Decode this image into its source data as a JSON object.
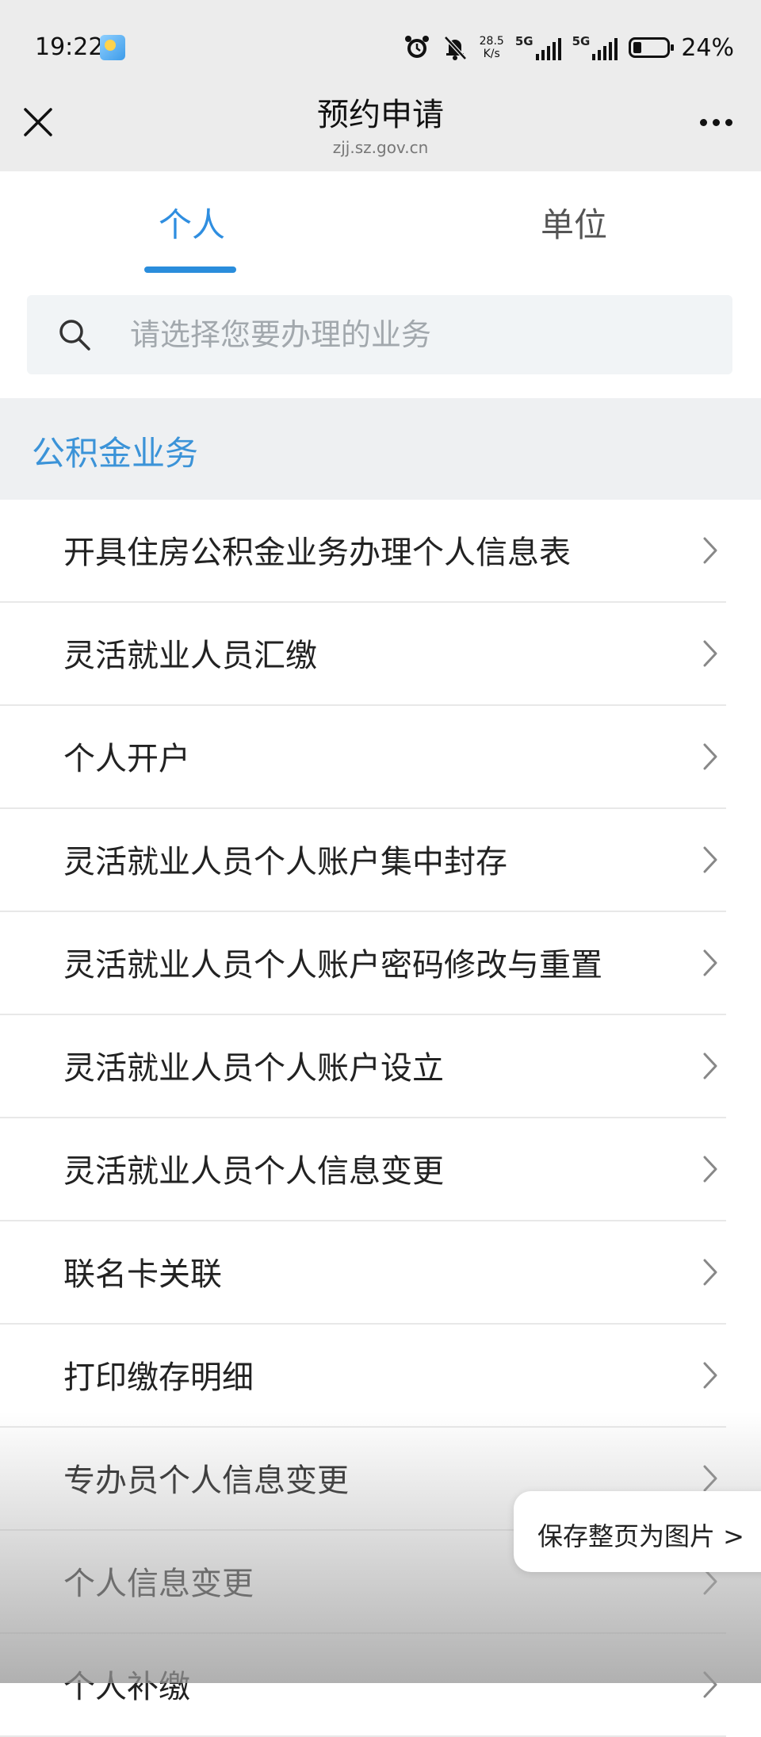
{
  "status_bar": {
    "time": "19:22",
    "net_speed_value": "28.5",
    "net_speed_unit": "K/s",
    "network_1": "5G",
    "network_2": "5G",
    "battery": "24%"
  },
  "header": {
    "title": "预约申请",
    "url": "zjj.sz.gov.cn"
  },
  "tabs": [
    {
      "label": "个人",
      "active": true
    },
    {
      "label": "单位",
      "active": false
    }
  ],
  "search": {
    "placeholder": "请选择您要办理的业务"
  },
  "section": {
    "title": "公积金业务"
  },
  "items": [
    {
      "label": "开具住房公积金业务办理个人信息表"
    },
    {
      "label": "灵活就业人员汇缴"
    },
    {
      "label": "个人开户"
    },
    {
      "label": "灵活就业人员个人账户集中封存"
    },
    {
      "label": "灵活就业人员个人账户密码修改与重置"
    },
    {
      "label": "灵活就业人员个人账户设立"
    },
    {
      "label": "灵活就业人员个人信息变更"
    },
    {
      "label": "联名卡关联"
    },
    {
      "label": "打印缴存明细"
    },
    {
      "label": "专办员个人信息变更"
    },
    {
      "label": "个人信息变更"
    },
    {
      "label": "个人补缴"
    }
  ],
  "save_page": {
    "label": "保存整页为图片 >"
  },
  "colors": {
    "accent": "#2a8ddc",
    "section_title": "#3b93d8",
    "header_bg": "#ececec"
  }
}
